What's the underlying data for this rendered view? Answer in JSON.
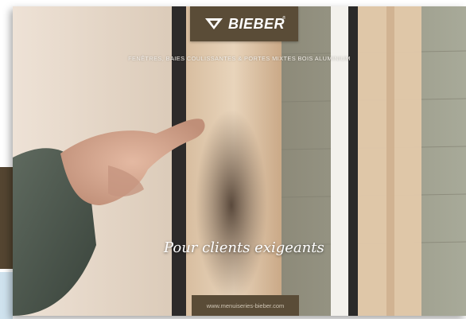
{
  "brand": {
    "name": "BIEBER",
    "registered_mark": "®",
    "color": "#5a4c37"
  },
  "tagline": "FENÊTRES, BAIES COULISSANTES & PORTES MIXTES BOIS ALUMINIUM",
  "slogan": "Pour clients exigeants",
  "website": "www.menuiseries-bieber.com",
  "colors": {
    "side_block_top": "#544531",
    "side_block_bottom": "#cfe2ee"
  },
  "icons": {
    "logo": "bieber-logo-icon"
  }
}
